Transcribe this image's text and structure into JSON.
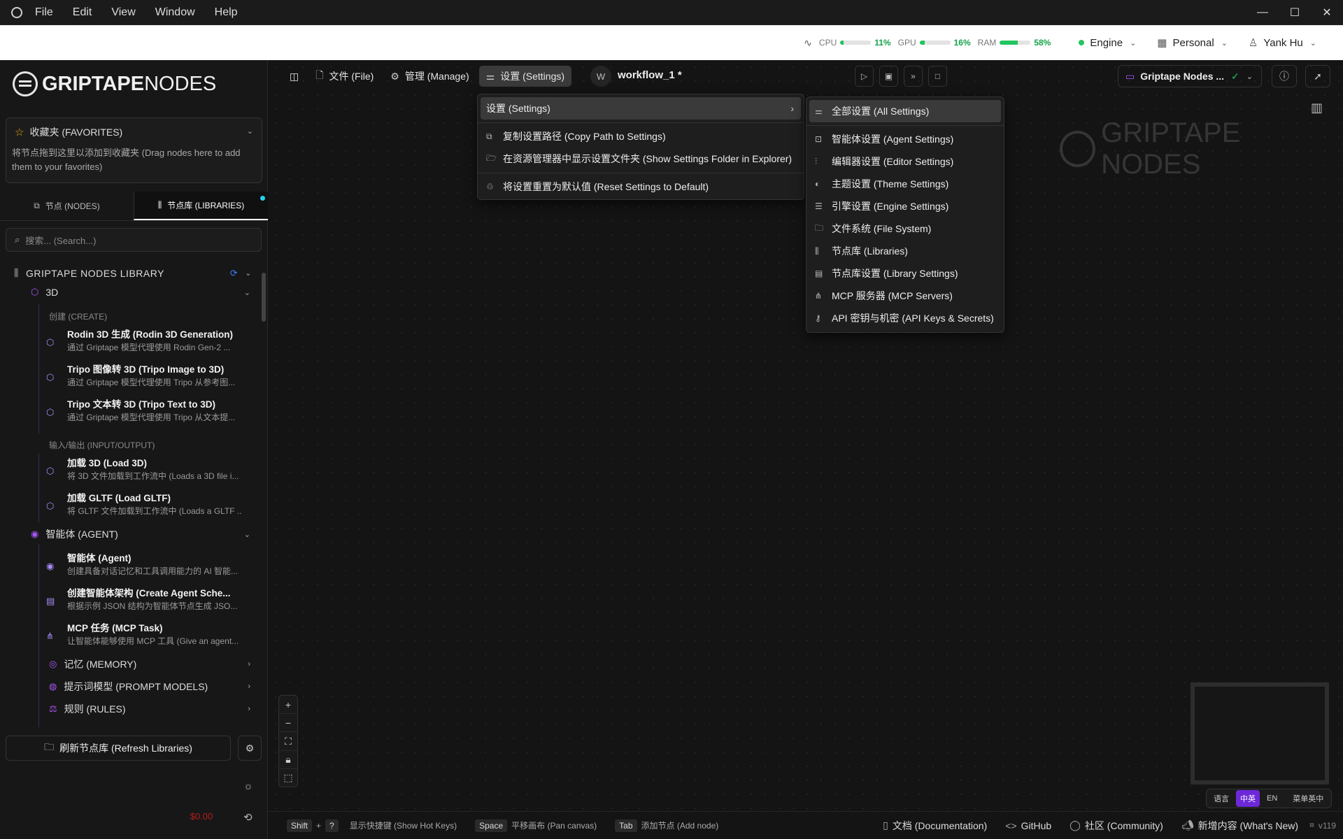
{
  "menubar": {
    "items": [
      "File",
      "Edit",
      "View",
      "Window",
      "Help"
    ],
    "controls": [
      "—",
      "☐",
      "✕"
    ]
  },
  "status": {
    "cpu": {
      "label": "CPU",
      "pct": "11%",
      "value": 0.11
    },
    "gpu": {
      "label": "GPU",
      "pct": "16%",
      "value": 0.16
    },
    "ram": {
      "label": "RAM",
      "pct": "58%",
      "value": 0.58
    },
    "engine": "Engine",
    "workspace": "Personal",
    "user": "Yank Hu"
  },
  "sidebar": {
    "logo_bold": "GRIPTAPE",
    "logo_light": "NODES",
    "favorites": {
      "title": "收藏夹 (FAVORITES)",
      "hint": "将节点拖到这里以添加到收藏夹 (Drag nodes here to add them to your favorites)"
    },
    "tabs": {
      "nodes": "节点 (NODES)",
      "libraries": "节点库 (LIBRARIES)"
    },
    "search_placeholder": "搜索... (Search...)",
    "library_title": "GRIPTAPE NODES LIBRARY",
    "cat_3d": "3D",
    "sub_create": "创建 (CREATE)",
    "sub_io": "输入/输出 (INPUT/OUTPUT)",
    "nodes_3d": [
      {
        "title": "Rodin 3D 生成 (Rodin 3D Generation)",
        "desc": "通过 Griptape 模型代理使用 Rodin Gen-2 ..."
      },
      {
        "title": "Tripo 图像转 3D (Tripo Image to 3D)",
        "desc": "通过 Griptape 模型代理使用 Tripo 从参考图..."
      },
      {
        "title": "Tripo 文本转 3D (Tripo Text to 3D)",
        "desc": "通过 Griptape 模型代理使用 Tripo 从文本提..."
      }
    ],
    "nodes_io": [
      {
        "title": "加载 3D (Load 3D)",
        "desc": "将 3D 文件加载到工作流中 (Loads a 3D file i..."
      },
      {
        "title": "加载 GLTF (Load GLTF)",
        "desc": "将 GLTF 文件加载到工作流中 (Loads a GLTF ..."
      }
    ],
    "cat_agent": "智能体 (AGENT)",
    "nodes_agent": [
      {
        "title": "智能体 (Agent)",
        "desc": "创建具备对话记忆和工具调用能力的 AI 智能..."
      },
      {
        "title": "创建智能体架构 (Create Agent Sche...",
        "desc": "根据示例 JSON 结构为智能体节点生成 JSO..."
      },
      {
        "title": "MCP 任务 (MCP Task)",
        "desc": "让智能体能够使用 MCP 工具 (Give an agent..."
      }
    ],
    "cat_memory": "记忆 (MEMORY)",
    "cat_prompt": "提示词模型 (PROMPT MODELS)",
    "cat_rules": "规则 (RULES)",
    "refresh": "刷新节点库 (Refresh Libraries)",
    "cost": "$0.00"
  },
  "toolbar": {
    "file": "文件 (File)",
    "manage": "管理 (Manage)",
    "settings": "设置 (Settings)",
    "avatar": "W",
    "workflow": "workflow_1 *",
    "engine_name": "Griptape Nodes ..."
  },
  "menu": {
    "settings": "设置 (Settings)",
    "copy_path": "复制设置路径 (Copy Path to Settings)",
    "show_folder": "在资源管理器中显示设置文件夹 (Show Settings Folder in Explorer)",
    "reset": "将设置重置为默认值 (Reset Settings to Default)"
  },
  "submenu": [
    "全部设置 (All Settings)",
    "智能体设置 (Agent Settings)",
    "编辑器设置 (Editor Settings)",
    "主题设置 (Theme Settings)",
    "引擎设置 (Engine Settings)",
    "文件系统 (File System)",
    "节点库 (Libraries)",
    "节点库设置 (Library Settings)",
    "MCP 服务器 (MCP Servers)",
    "API 密钥与机密 (API Keys & Secrets)"
  ],
  "watermark": "GRIPTAPE NODES",
  "lang": {
    "label": "语言",
    "zh_en": "中英",
    "en": "EN",
    "menu": "菜单英中"
  },
  "footer": {
    "shift": "Shift",
    "plus": "+",
    "q": "?",
    "hotkeys": "显示快捷键 (Show Hot Keys)",
    "space": "Space",
    "pan": "平移画布 (Pan canvas)",
    "tab": "Tab",
    "add": "添加节点 (Add node)",
    "docs": "文档 (Documentation)",
    "github": "GitHub",
    "community": "社区 (Community)",
    "whatsnew": "新增内容 (What's New)",
    "version": "v119"
  },
  "colors": {
    "accent": "#a855f7",
    "ok": "#22c55e",
    "meter": "#22c55e",
    "lang_active": "#6d28d9"
  }
}
